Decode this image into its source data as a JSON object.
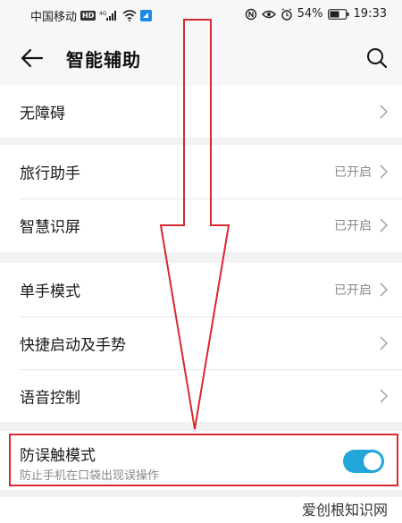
{
  "status_bar": {
    "carrier": "中国移动",
    "hd": "HD",
    "network": "4G",
    "battery": "54%",
    "time": "19:33"
  },
  "header": {
    "title": "智能辅助",
    "back_icon": "arrow-left-icon",
    "search_icon": "search-icon"
  },
  "groups": [
    {
      "items": [
        {
          "label": "无障碍",
          "value": ""
        }
      ]
    },
    {
      "items": [
        {
          "label": "旅行助手",
          "value": "已开启"
        },
        {
          "label": "智慧识屏",
          "value": "已开启"
        }
      ]
    },
    {
      "items": [
        {
          "label": "单手模式",
          "value": "已开启"
        },
        {
          "label": "快捷启动及手势",
          "value": ""
        },
        {
          "label": "语音控制",
          "value": ""
        }
      ]
    }
  ],
  "toggle_item": {
    "label": "防误触模式",
    "subtitle": "防止手机在口袋出现误操作",
    "enabled": true
  },
  "watermark": "爱创根知识网",
  "colors": {
    "accent": "#22a5d8",
    "highlight": "#d9282f",
    "background": "#f2f2f2"
  }
}
